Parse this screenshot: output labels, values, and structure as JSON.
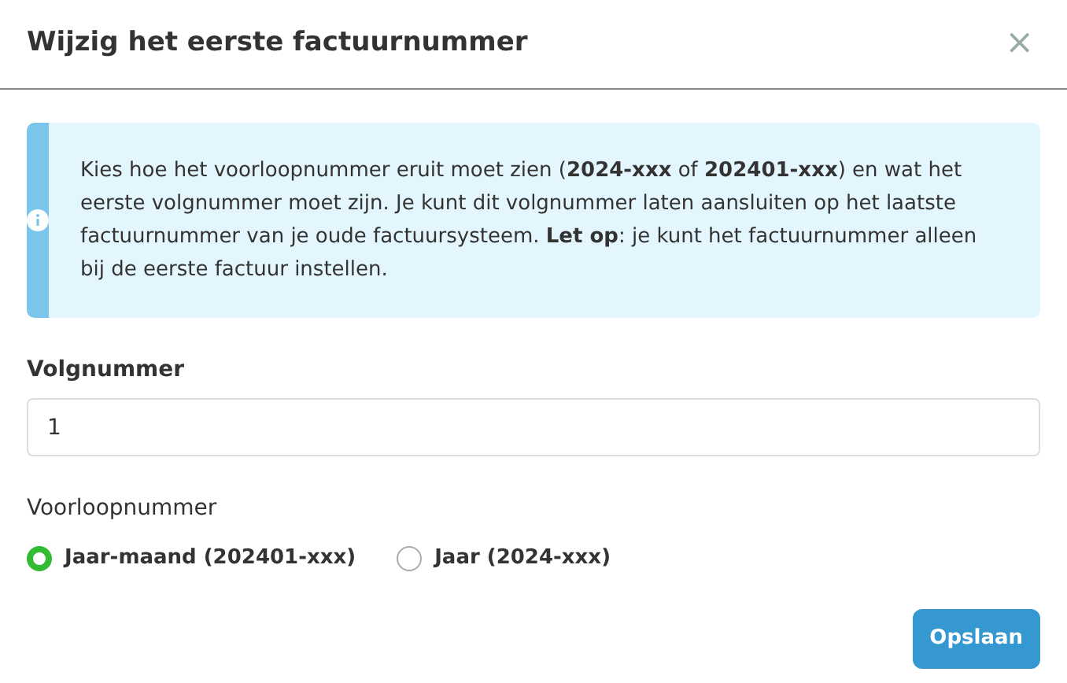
{
  "dialog": {
    "title": "Wijzig het eerste factuurnummer",
    "close": "×"
  },
  "notice": {
    "text": "Kies hoe het voorloopnummer eruit moet zien (**2024-xxx** of **202401-xxx**) en wat het eerste volgnummer moet zijn. Je kunt dit volgnummer laten aansluiten op het laatste factuurnummer van je oude factuursysteem. **Let op**: je kunt het factuurnummer alleen bij de eerste factuur instellen."
  },
  "volgnummer": {
    "label": "Volgnummer",
    "value": "1"
  },
  "voorloopnummer": {
    "label": "Voorloopnummer",
    "options": [
      {
        "label": "Jaar-maand (202401-xxx)",
        "selected": true
      },
      {
        "label": "Jaar (2024-xxx)",
        "selected": false
      }
    ]
  },
  "buttons": [
    "Opslaan"
  ]
}
